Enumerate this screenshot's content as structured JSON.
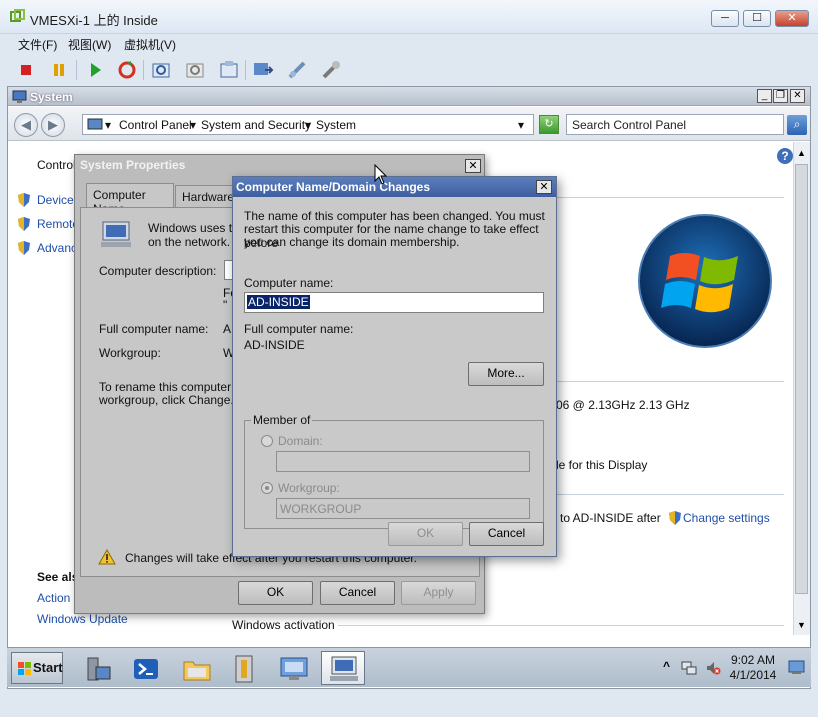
{
  "vm_window": {
    "title": "VMESXi-1 上的 Inside",
    "controls": {
      "minimize": "─",
      "maximize": "☐",
      "close": "✕"
    },
    "menu": [
      "文件(F)",
      "视图(W)",
      "虚拟机(V)"
    ]
  },
  "system_window": {
    "title": "System",
    "controls": {
      "minimize": "_",
      "restore": "❐",
      "close": "✕"
    },
    "breadcrumb": [
      "Control Panel",
      "System and Security",
      "System"
    ],
    "search_placeholder": "Search Control Panel",
    "help": "?",
    "left_heading": "Control",
    "left_links": [
      "Device M",
      "Remote",
      "Advanc"
    ],
    "see_also": {
      "heading": "See als",
      "links": [
        "Action C",
        "Windows Update"
      ]
    },
    "processor_text": "06  @ 2.13GHz   2.13 GHz",
    "display_text": "le for this Display",
    "pending_text": "to AD-INSIDE after",
    "change_settings": "Change settings",
    "windows_activation": "Windows activation"
  },
  "system_properties": {
    "title": "System Properties",
    "tabs": [
      "Computer Name",
      "Hardware"
    ],
    "intro": [
      "Windows uses th",
      "on the network."
    ],
    "description_label": "Computer description:",
    "desc_hint": [
      "Fo",
      "\""
    ],
    "full_name_label": "Full computer name:",
    "full_name_value": "A",
    "workgroup_label": "Workgroup:",
    "workgroup_value": "W",
    "rename_text": [
      "To rename this computer or",
      "workgroup, click Change."
    ],
    "warning": "Changes will take effect after you restart this computer.",
    "buttons": {
      "ok": "OK",
      "cancel": "Cancel",
      "apply": "Apply"
    }
  },
  "name_changes": {
    "title": "Computer Name/Domain Changes",
    "message": [
      "The name of this computer has been changed.  You must",
      "restart this computer for the name change to take effect before",
      "you can change its domain membership."
    ],
    "computer_name_label": "Computer name:",
    "computer_name_value": "AD-INSIDE",
    "full_name_label": "Full computer name:",
    "full_name_value": "AD-INSIDE",
    "more_button": "More...",
    "member_of": "Member of",
    "domain_label": "Domain:",
    "domain_value": "",
    "workgroup_label": "Workgroup:",
    "workgroup_value": "WORKGROUP",
    "buttons": {
      "ok": "OK",
      "cancel": "Cancel"
    }
  },
  "taskbar": {
    "start": "Start",
    "time": "9:02 AM",
    "date": "4/1/2014",
    "tray_chevron": "^"
  }
}
